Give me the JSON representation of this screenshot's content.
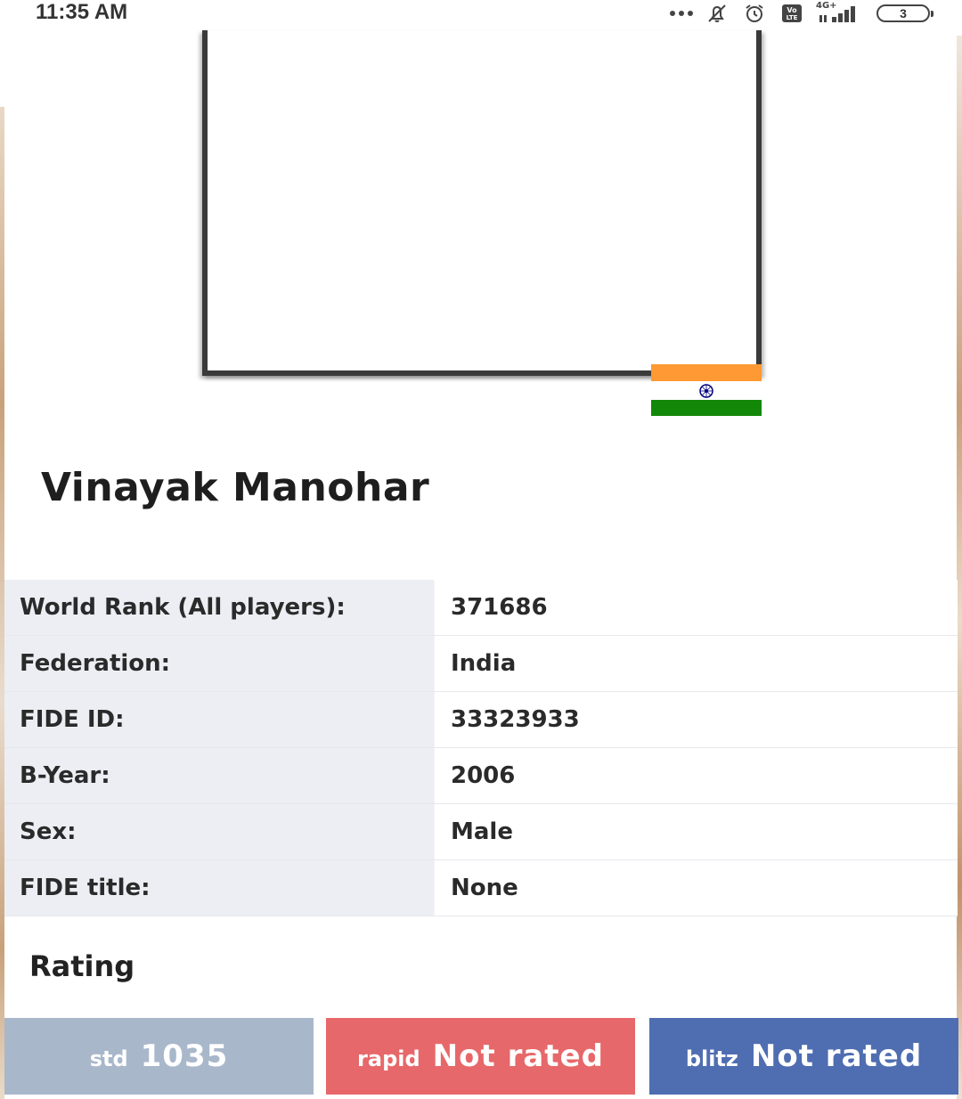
{
  "status_bar": {
    "time": "11:35 AM",
    "network_label": "4G+",
    "volte_label": "Vo LTE",
    "battery_level": "3",
    "icons": [
      "more-dots-icon",
      "notifications-muted-icon",
      "alarm-icon",
      "volte-icon",
      "signal-icon",
      "battery-icon"
    ]
  },
  "profile": {
    "photo_icon": "player-photo-placeholder",
    "federation_flag_icon": "india-flag-icon",
    "name": "Vinayak Manohar"
  },
  "info": {
    "rows": [
      {
        "label": "World Rank (All players):",
        "value": "371686"
      },
      {
        "label": "Federation:",
        "value": "India"
      },
      {
        "label": "FIDE ID:",
        "value": "33323933"
      },
      {
        "label": "B-Year:",
        "value": "2006"
      },
      {
        "label": "Sex:",
        "value": "Male"
      },
      {
        "label": "FIDE title:",
        "value": "None"
      }
    ]
  },
  "rating": {
    "heading": "Rating",
    "buttons": [
      {
        "kind": "std",
        "value": "1035",
        "color": "#a9b7cb"
      },
      {
        "kind": "rapid",
        "value": "Not rated",
        "color": "#e7686a"
      },
      {
        "kind": "blitz",
        "value": "Not rated",
        "color": "#4f6db1"
      }
    ]
  },
  "colors": {
    "label_bg": "#eceef3",
    "flag_saffron": "#ff9933",
    "flag_green": "#138808",
    "flag_chakra": "#000080"
  }
}
